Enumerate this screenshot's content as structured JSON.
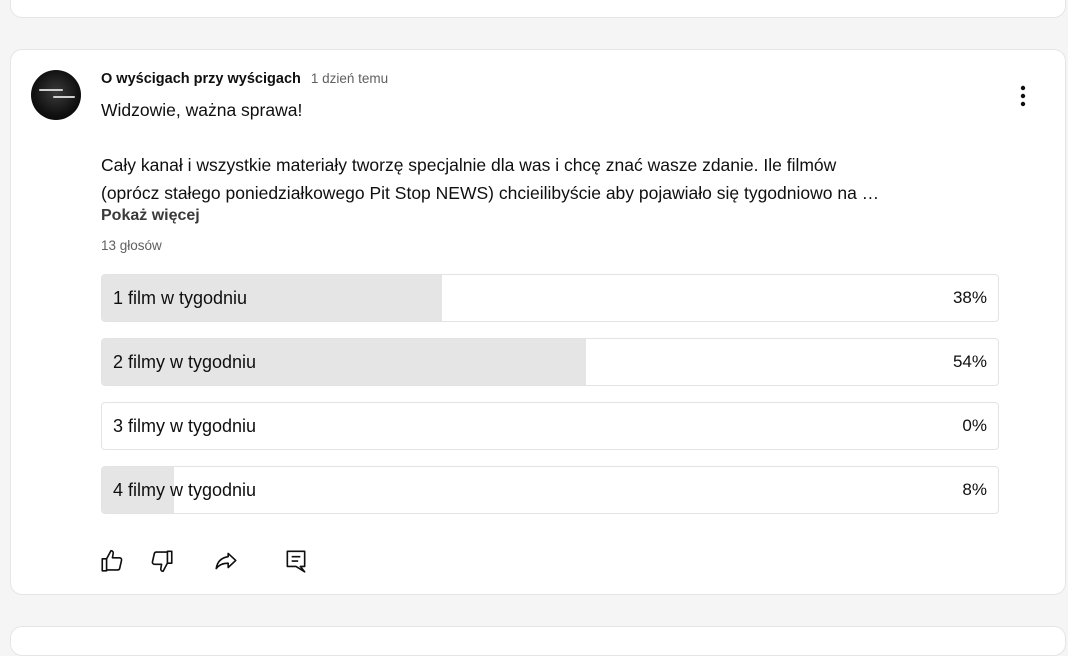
{
  "post": {
    "author": "O wyścigach przy wyścigach",
    "time": "1 dzień temu",
    "title": "Widzowie, ważna sprawa!",
    "body_lines": [
      "Cały kanał i wszystkie materiały tworzę specjalnie dla was i chcę znać wasze zdanie. Ile filmów",
      "(oprócz stałego poniedziałkowego Pit Stop NEWS) chcieilibyście aby pojawiało się tygodniowo na …"
    ],
    "show_more": "Pokaż więcej",
    "votes": "13 głosów"
  },
  "poll": {
    "options": [
      {
        "label": "1 film w tygodniu",
        "percent_text": "38%",
        "percent": 38
      },
      {
        "label": "2 filmy w tygodniu",
        "percent_text": "54%",
        "percent": 54
      },
      {
        "label": "3 filmy w tygodniu",
        "percent_text": "0%",
        "percent": 0
      },
      {
        "label": "4 filmy w tygodniu",
        "percent_text": "8%",
        "percent": 8
      }
    ]
  },
  "icons": {
    "menu": "more-vert-icon",
    "like": "thumb-up-icon",
    "dislike": "thumb-down-icon",
    "share": "share-icon",
    "comment": "comment-icon"
  },
  "colors": {
    "bar_fill": "#e5e5e5",
    "text": "#0f0f0f",
    "secondary_text": "#606060"
  }
}
